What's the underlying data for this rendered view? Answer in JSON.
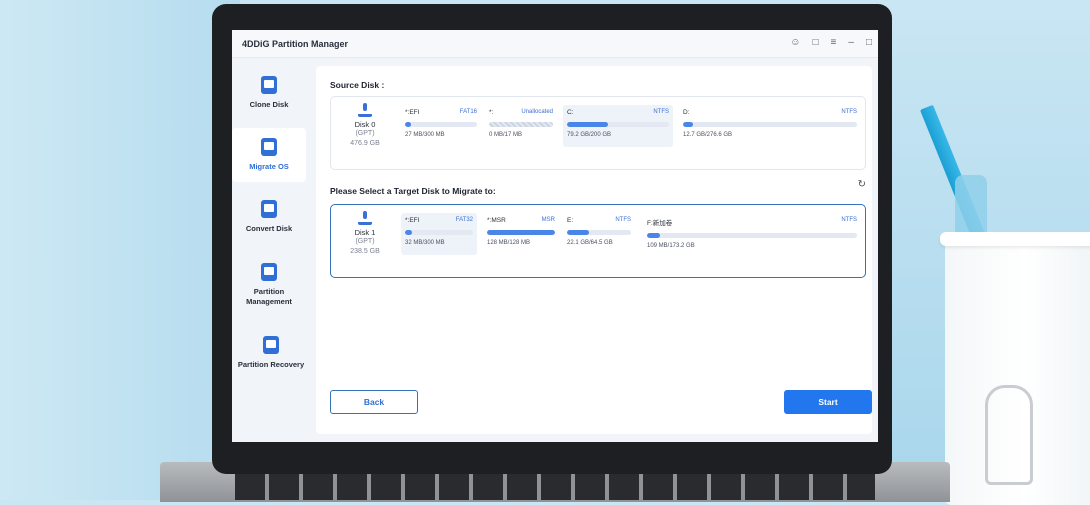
{
  "app": {
    "title": "4DDiG Partition Manager"
  },
  "titlebar": {
    "icons": [
      "account-icon",
      "feedback-icon",
      "menu-icon",
      "minimize-icon",
      "maximize-icon"
    ]
  },
  "sidebar": {
    "items": [
      {
        "label": "Clone Disk",
        "icon": "clone-disk-icon",
        "active": false
      },
      {
        "label": "Migrate OS",
        "icon": "migrate-os-icon",
        "active": true
      },
      {
        "label": "Convert Disk",
        "icon": "convert-disk-icon",
        "active": false
      },
      {
        "label": "Partition Management",
        "icon": "partition-management-icon",
        "active": false
      },
      {
        "label": "Partition Recovery",
        "icon": "partition-recovery-icon",
        "active": false
      }
    ]
  },
  "source": {
    "title": "Source Disk :",
    "disk": {
      "name": "Disk 0",
      "scheme": "(GPT)",
      "size": "476.9 GB"
    },
    "partitions": [
      {
        "label": "*:EFI",
        "type": "FAT16",
        "size": "27 MB/300 MB",
        "fill": 0.09,
        "selected": false,
        "hatched": false
      },
      {
        "label": "*:",
        "type": "Unallocated",
        "size": "0 MB/17 MB",
        "fill": 0,
        "selected": false,
        "hatched": true
      },
      {
        "label": "C:",
        "type": "NTFS",
        "size": "79.2 GB/200 GB",
        "fill": 0.4,
        "selected": true,
        "hatched": false
      },
      {
        "label": "D:",
        "type": "NTFS",
        "size": "12.7 GB/276.6 GB",
        "fill": 0.05,
        "selected": false,
        "hatched": false
      }
    ]
  },
  "target": {
    "title": "Please Select a Target Disk to Migrate to:",
    "disk": {
      "name": "Disk 1",
      "scheme": "(GPT)",
      "size": "238.5 GB"
    },
    "partitions": [
      {
        "label": "*:EFI",
        "type": "FAT32",
        "size": "32 MB/300 MB",
        "fill": 0.1,
        "selected": true
      },
      {
        "label": "*:MSR",
        "type": "MSR",
        "size": "128 MB/128 MB",
        "fill": 1.0,
        "selected": false
      },
      {
        "label": "E:",
        "type": "NTFS",
        "size": "22.1 GB/64.5 GB",
        "fill": 0.34,
        "selected": false
      },
      {
        "label": "F:新加卷",
        "type": "NTFS",
        "size": "109 MB/173.2 GB",
        "fill": 0.01,
        "selected": false
      }
    ]
  },
  "actions": {
    "back": "Back",
    "start": "Start"
  },
  "colors": {
    "accent": "#2277ee",
    "selected_bg": "#eef2f9"
  }
}
